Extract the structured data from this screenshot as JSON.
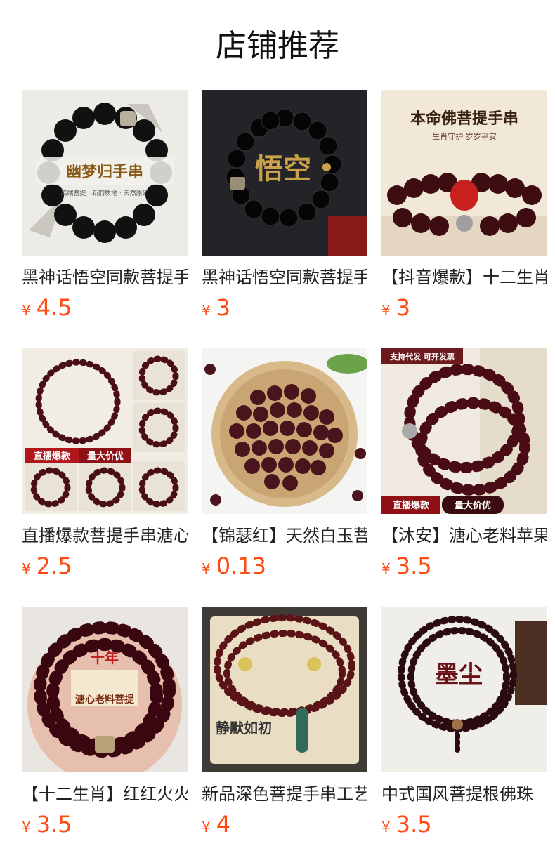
{
  "header": {
    "title": "店铺推荐"
  },
  "currency": "¥",
  "products": [
    {
      "name": "黑神话悟空同款菩提手串",
      "price": "4.5",
      "tags": [
        "幽梦归手串",
        "高端菩提 · 新韵质地 · 天然原矿"
      ]
    },
    {
      "name": "黑神话悟空同款菩提手串",
      "price": "3",
      "tags": [
        "悟空"
      ]
    },
    {
      "name": "【抖音爆款】十二生肖",
      "price": "3",
      "tags": [
        "本命佛菩提手串",
        "生肖守护 岁岁平安"
      ]
    },
    {
      "name": "直播爆款菩提手串溏心",
      "price": "2.5",
      "tags": [
        "直播爆款",
        "量大价优"
      ]
    },
    {
      "name": "【锦瑟红】天然白玉菩提",
      "price": "0.13",
      "tags": []
    },
    {
      "name": "【沐安】溏心老料苹果",
      "price": "3.5",
      "tags": [
        "支持代发 可开发票",
        "直播爆款",
        "量大价优"
      ]
    },
    {
      "name": "【十二生肖】红红火火",
      "price": "3.5",
      "tags": [
        "十年",
        "溏心老料菩提"
      ]
    },
    {
      "name": "新品深色菩提手串工艺",
      "price": "4",
      "tags": [
        "静默如初"
      ]
    },
    {
      "name": "中式国风菩提根佛珠",
      "price": "3.5",
      "tags": [
        "墨尘"
      ]
    }
  ]
}
